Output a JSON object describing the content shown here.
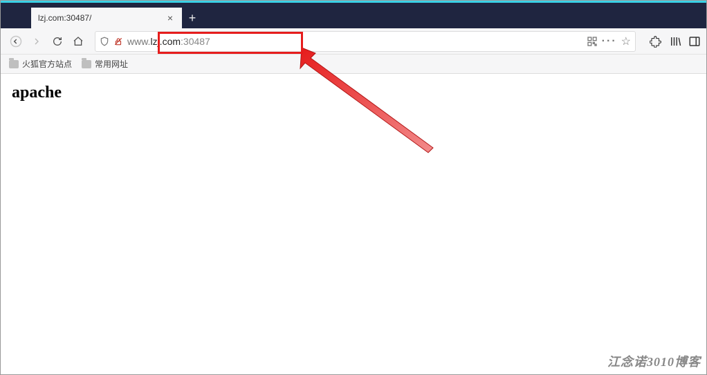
{
  "tab": {
    "title": "lzj.com:30487/",
    "close_glyph": "×"
  },
  "newtab_glyph": "+",
  "nav": {
    "back_glyph": "←",
    "forward_glyph": "→",
    "reload_glyph": "↻",
    "home_glyph": "⌂"
  },
  "url": {
    "prefix": "www.",
    "host": "lzj.com",
    "port": ":30487"
  },
  "urlbar_icons": {
    "shield": "shield-icon",
    "lock": "lock-strikethrough-icon",
    "qr": "qr-icon",
    "overflow": "···",
    "bookmark": "☆"
  },
  "right_icons": {
    "puzzle": "puzzle-icon",
    "library": "library-icon",
    "sidebar": "sidebar-icon"
  },
  "bookmarks": [
    {
      "label": "火狐官方站点"
    },
    {
      "label": "常用网址"
    }
  ],
  "page": {
    "heading": "apache"
  },
  "watermark": "江念诺3010博客"
}
